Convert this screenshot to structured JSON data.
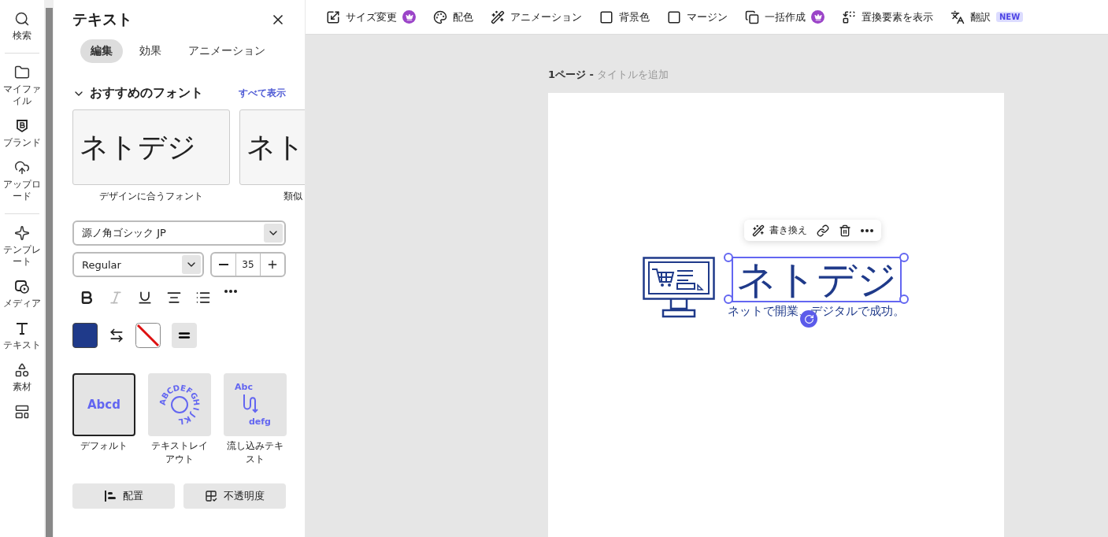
{
  "rail": [
    {
      "label": "検索"
    },
    {
      "label": "マイファイル"
    },
    {
      "label": "ブランド"
    },
    {
      "label": "アップロード"
    },
    {
      "label": "テンプレート"
    },
    {
      "label": "メディア"
    },
    {
      "label": "テキスト"
    },
    {
      "label": "素材"
    }
  ],
  "panel": {
    "title": "テキスト",
    "tabs": [
      {
        "label": "編集",
        "selected": true
      },
      {
        "label": "効果",
        "selected": false
      },
      {
        "label": "アニメーション",
        "selected": false
      }
    ],
    "fonts_section": {
      "title": "おすすめのフォント",
      "expanded": true,
      "link": "すべて表示",
      "cards": [
        {
          "preview": "ネトデジ",
          "caption": "デザインに合うフォント"
        },
        {
          "preview": "ネト",
          "caption": "類似"
        }
      ]
    },
    "font_family": "源ノ角ゴシック JP",
    "font_weight": "Regular",
    "font_size": "35",
    "format_buttons": [
      {
        "kind": "bold",
        "disabled": false
      },
      {
        "kind": "italic",
        "disabled": true
      },
      {
        "kind": "underline",
        "disabled": false
      },
      {
        "kind": "align",
        "disabled": false
      },
      {
        "kind": "list",
        "disabled": false
      },
      {
        "kind": "more",
        "disabled": false
      }
    ],
    "styles": [
      {
        "kind": "default",
        "preview": "Abcd",
        "label": "デフォルト",
        "selected": true
      },
      {
        "kind": "circle",
        "preview": "ABCDEFGHIJKL",
        "label": "テキストレイアウト",
        "selected": false
      },
      {
        "kind": "flow",
        "preview": "Abc",
        "preview_2": "defg",
        "label": "流し込みテキスト",
        "selected": false
      }
    ],
    "bottom_buttons": [
      {
        "kind": "align",
        "label": "配置"
      },
      {
        "kind": "opacity",
        "label": "不透明度"
      }
    ]
  },
  "toolbar": [
    {
      "label": "サイズ変更",
      "premium": true
    },
    {
      "label": "配色",
      "premium": false
    },
    {
      "label": "アニメーション",
      "premium": false
    },
    {
      "label": "背景色",
      "premium": false
    },
    {
      "label": "マージン",
      "premium": false
    },
    {
      "label": "一括作成",
      "premium": true
    },
    {
      "label": "置換要素を表示",
      "premium": false
    },
    {
      "label": "翻訳",
      "premium": false,
      "badge": "NEW"
    }
  ],
  "page": {
    "number": "1ページ -",
    "title_placeholder": "タイトルを追加",
    "float_toolbar": {
      "rewrite": "書き換え"
    },
    "heading": "ネトデジ",
    "heading_selected": true,
    "subtitle": "ネットで開業、デジタルで成功。"
  }
}
